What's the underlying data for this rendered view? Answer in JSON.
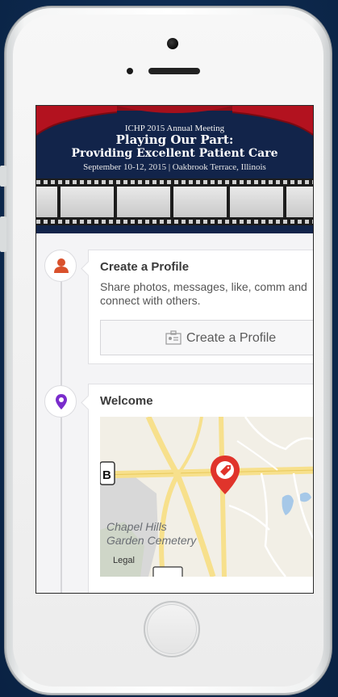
{
  "banner": {
    "meeting": "ICHP 2015 Annual Meeting",
    "title_line1": "Playing Our Part:",
    "title_line2": "Providing Excellent Patient Care",
    "date_location": "September 10-12, 2015 | Oakbrook Terrace, Illinois"
  },
  "timeline": [
    {
      "icon": "person-icon",
      "icon_color": "#d9512c",
      "title": "Create a Profile",
      "description": "Share photos, messages, like, comm and connect with others.",
      "button_label": "Create a Profile",
      "button_icon": "id-card-icon"
    },
    {
      "icon": "location-pin-icon",
      "icon_color": "#7a2ccc",
      "title": "Welcome",
      "map": {
        "labels": [
          "Chapel Hills",
          "Garden Cemetery"
        ],
        "legal": "Legal",
        "marker_color": "#e0342b",
        "road_sign": "B"
      }
    }
  ],
  "colors": {
    "banner_bg": "#12244a",
    "curtain": "#b3121f",
    "page_bg": "#0d2a4f"
  }
}
